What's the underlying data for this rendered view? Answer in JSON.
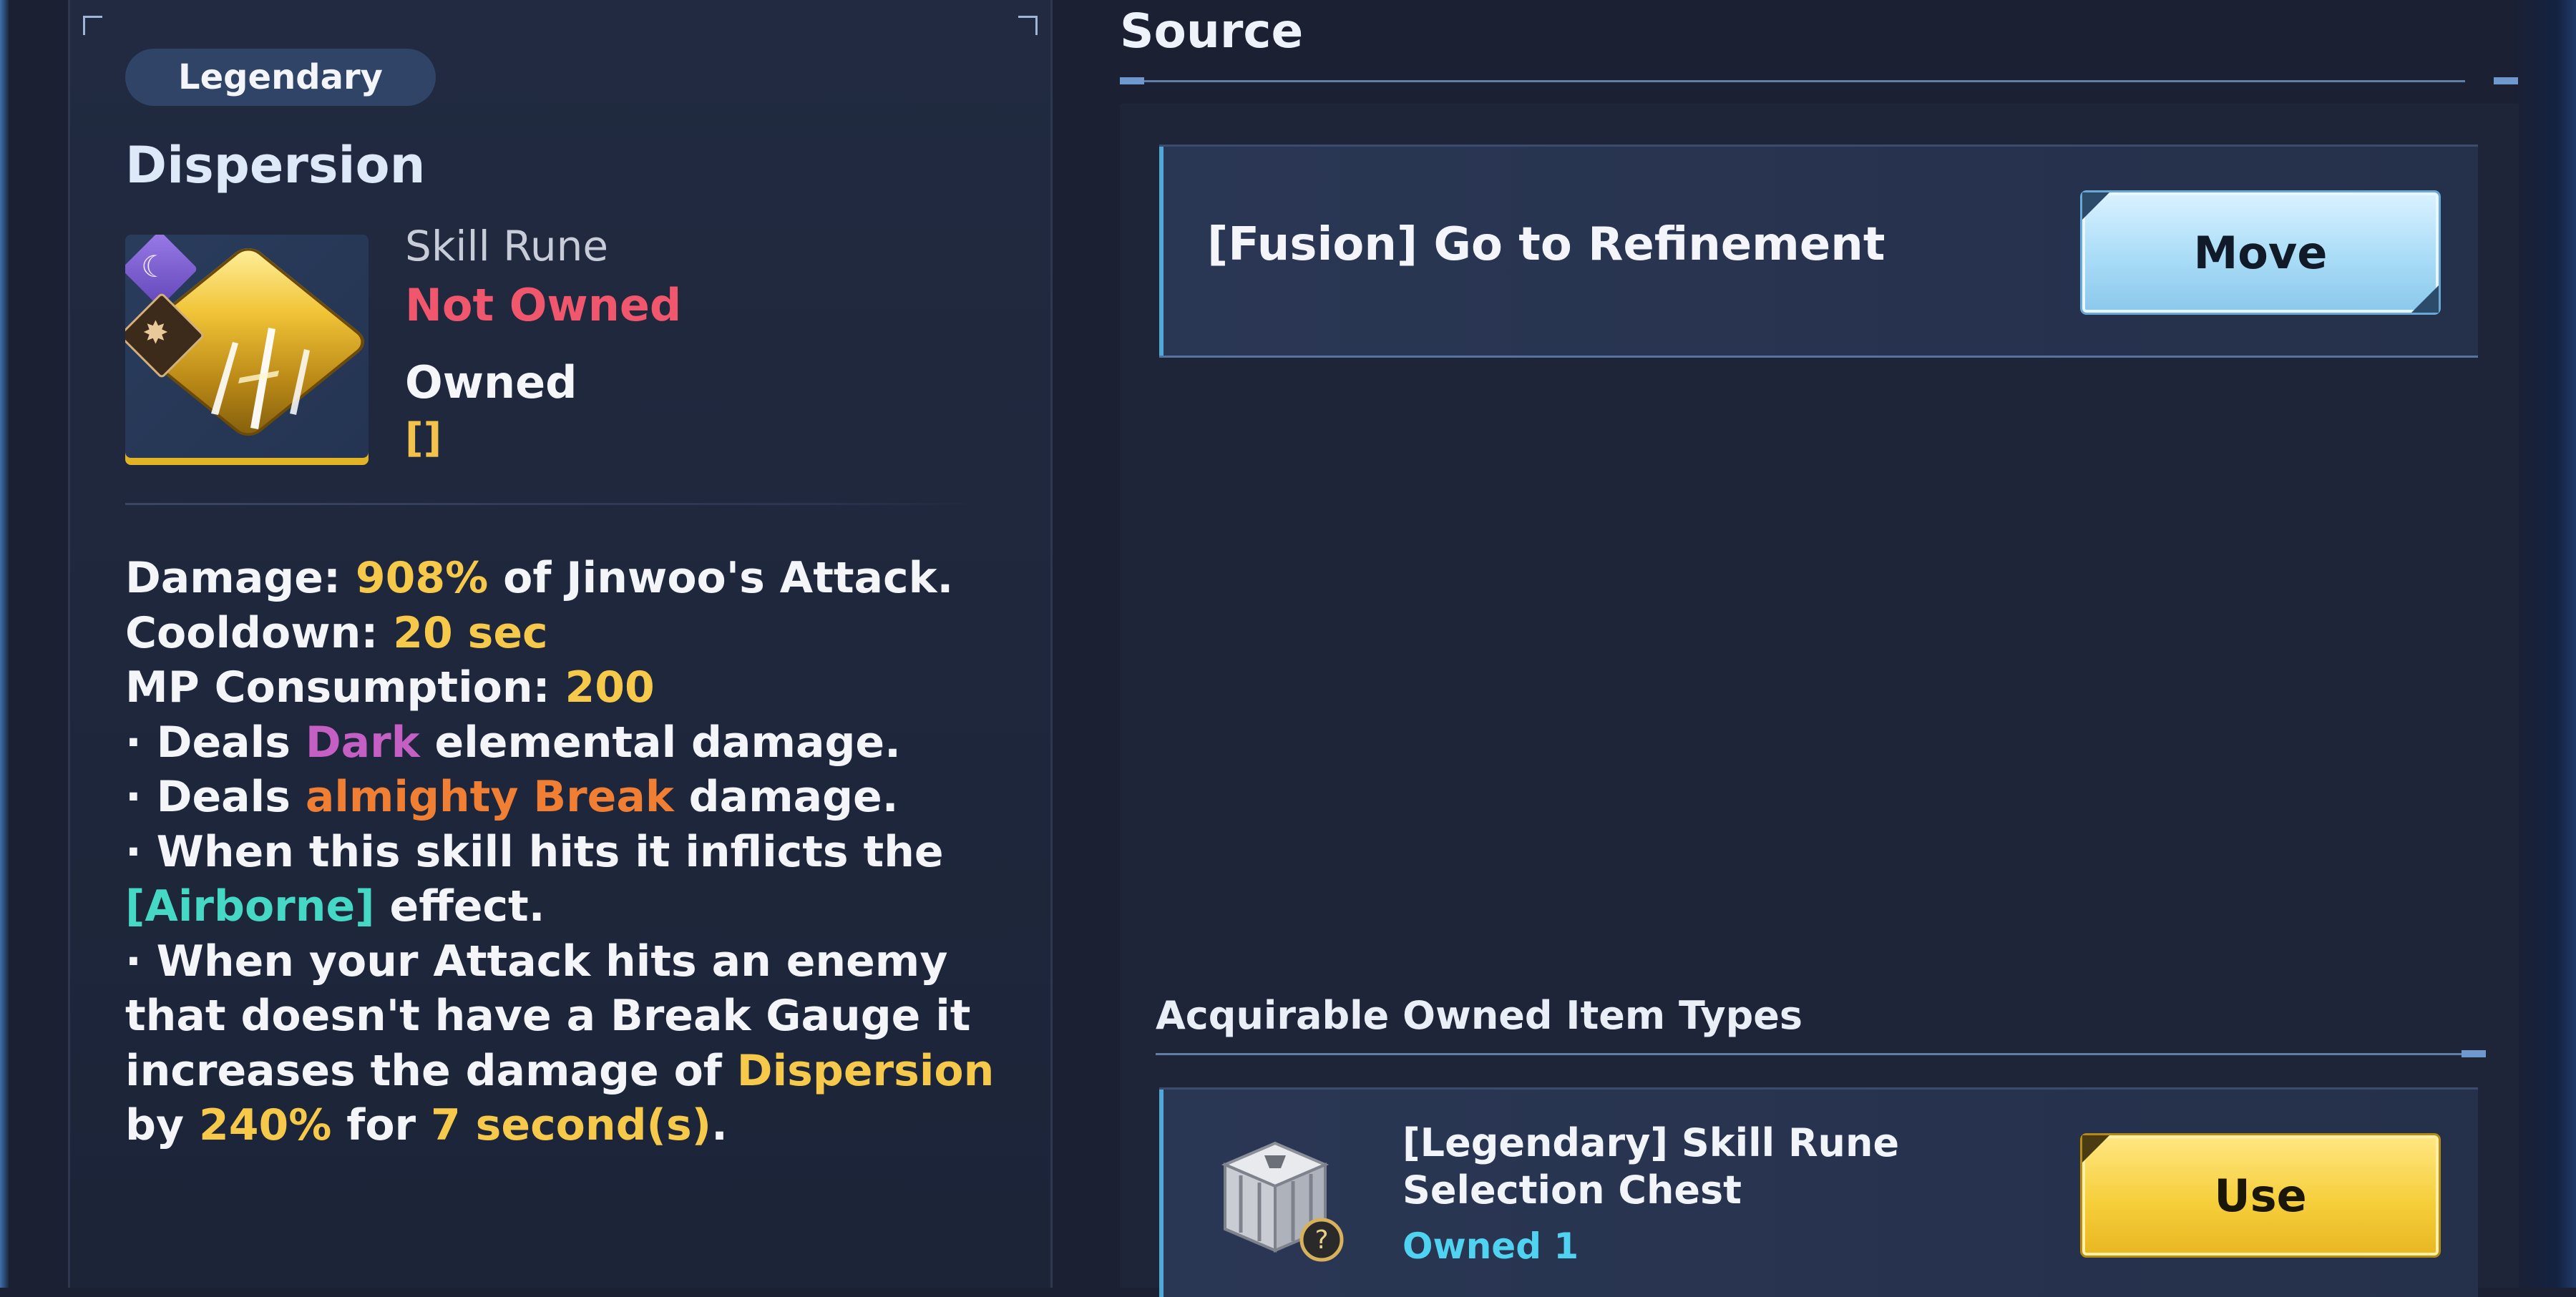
{
  "detail": {
    "rarity": "Legendary",
    "name": "Dispersion",
    "type": "Skill Rune",
    "ownership_status": "Not Owned",
    "owned_label": "Owned",
    "owned_count": "[]",
    "icon": "skill-rune-icon",
    "description": {
      "damage_label": "Damage: ",
      "damage_value": "908%",
      "damage_suffix": " of Jinwoo's Attack.",
      "cooldown_label": "Cooldown: ",
      "cooldown_value": "20 sec",
      "mp_label": "MP Consumption: ",
      "mp_value": "200",
      "b1_prefix": "· Deals ",
      "b1_element": "Dark",
      "b1_suffix": " elemental damage.",
      "b2_prefix": "· Deals ",
      "b2_highlight": "almighty Break",
      "b2_suffix": " damage.",
      "b3_line1": "· When this skill hits it inflicts the",
      "b3_effect": "[Airborne]",
      "b3_suffix": " effect.",
      "b4_line1": "· When your Attack hits an enemy",
      "b4_line2": "that doesn't have a Break Gauge it",
      "b4_line3_prefix": "increases the damage of ",
      "b4_skill": "Dispersion",
      "b4_by": "by ",
      "b4_percent": "240%",
      "b4_for": " for ",
      "b4_duration": "7 second(s)",
      "b4_end": "."
    }
  },
  "source": {
    "title": "Source",
    "items": [
      {
        "label": "[Fusion] Go to Refinement",
        "button": "Move"
      }
    ]
  },
  "acquirable": {
    "title": "Acquirable Owned Item Types",
    "items": [
      {
        "name_line1": "[Legendary] Skill Rune",
        "name_line2": "Selection Chest",
        "owned": "Owned 1",
        "button": "Use",
        "icon": "chest-icon"
      }
    ]
  },
  "colors": {
    "highlight_yellow": "#f7c94a",
    "dark_element": "#c45fc4",
    "break_orange": "#f07f33",
    "effect_cyan": "#45d8c4",
    "not_owned_red": "#f0566c",
    "owned_count_cyan": "#4fd3f0"
  }
}
